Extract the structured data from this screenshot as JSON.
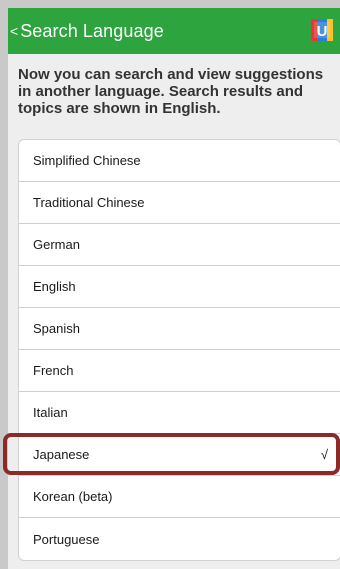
{
  "header": {
    "back_glyph": "<",
    "title": "Search Language",
    "logo_letter": "U"
  },
  "intro_text": "Now you can search and view suggestions in another language. Search results and topics are shown in English.",
  "languages": [
    {
      "label": "Simplified Chinese"
    },
    {
      "label": "Traditional Chinese"
    },
    {
      "label": "German"
    },
    {
      "label": "English"
    },
    {
      "label": "Spanish"
    },
    {
      "label": "French"
    },
    {
      "label": "Italian"
    },
    {
      "label": "Japanese",
      "check": "√"
    },
    {
      "label": "Korean (beta)"
    },
    {
      "label": "Portuguese"
    }
  ],
  "colors": {
    "header_bg": "#2ea43e",
    "highlight": "#8c2a2a"
  }
}
